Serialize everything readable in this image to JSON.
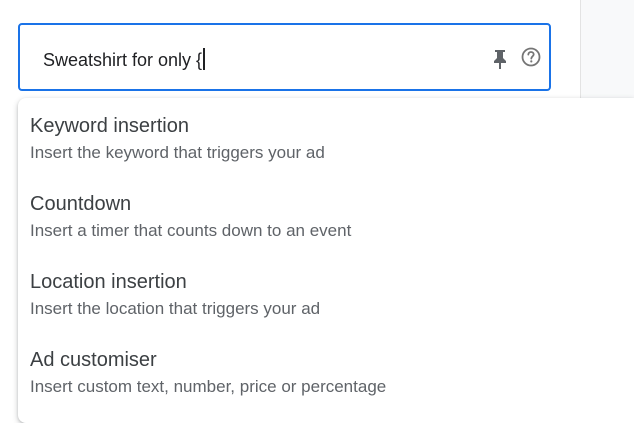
{
  "headline_field": {
    "value": "Sweatshirt for only {"
  },
  "icons": {
    "pin": "pin-icon",
    "help": "help-circle-icon",
    "help_color": "#757575",
    "pin_color": "#5f6368"
  },
  "colors": {
    "focus_border": "#1a73e8",
    "title_text": "#3c4043",
    "desc_text": "#5f6368"
  },
  "menu": {
    "items": [
      {
        "title": "Keyword insertion",
        "description": "Insert the keyword that triggers your ad"
      },
      {
        "title": "Countdown",
        "description": "Insert a timer that counts down to an event"
      },
      {
        "title": "Location insertion",
        "description": "Insert the location that triggers your ad"
      },
      {
        "title": "Ad customiser",
        "description": "Insert custom text, number, price or percentage"
      }
    ]
  }
}
